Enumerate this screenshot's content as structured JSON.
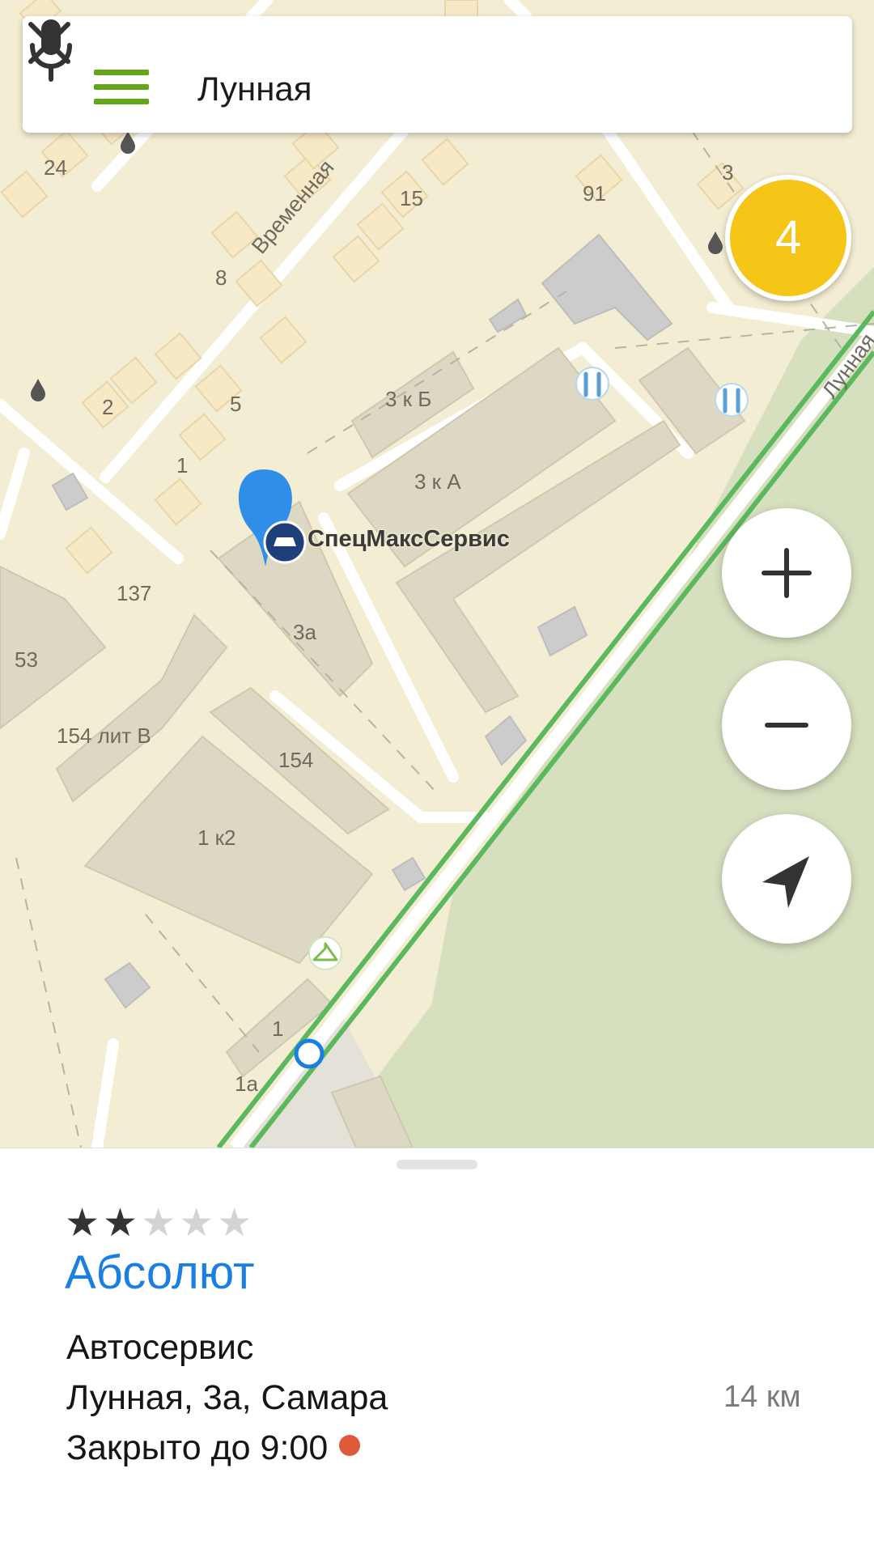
{
  "search": {
    "query": "Лунная"
  },
  "map": {
    "cluster_count": "4",
    "selected_place_label": "СпецМаксСервис",
    "street_labels": [
      "Временная",
      "Лунная"
    ],
    "building_numbers": [
      "24",
      "8",
      "15",
      "91",
      "3",
      "2",
      "5",
      "1",
      "137",
      "53",
      "3 к Б",
      "3 к А",
      "3а",
      "154 лит В",
      "154",
      "1 к2",
      "1",
      "1а"
    ],
    "route_color": "#5cb85c",
    "park_color": "#d6e0bf"
  },
  "controls": {
    "zoom_in_icon": "plus-icon",
    "zoom_out_icon": "minus-icon",
    "locate_icon": "navigation-arrow-icon"
  },
  "place": {
    "rating_stars": 2,
    "rating_max": 5,
    "name": "Абсолют",
    "category": "Автосервис",
    "address": "Лунная, 3а, Самара",
    "hours_status": "Закрыто до 9:00",
    "distance": "14 км",
    "status_color": "#e05a3a",
    "name_color": "#1a7fe0"
  }
}
